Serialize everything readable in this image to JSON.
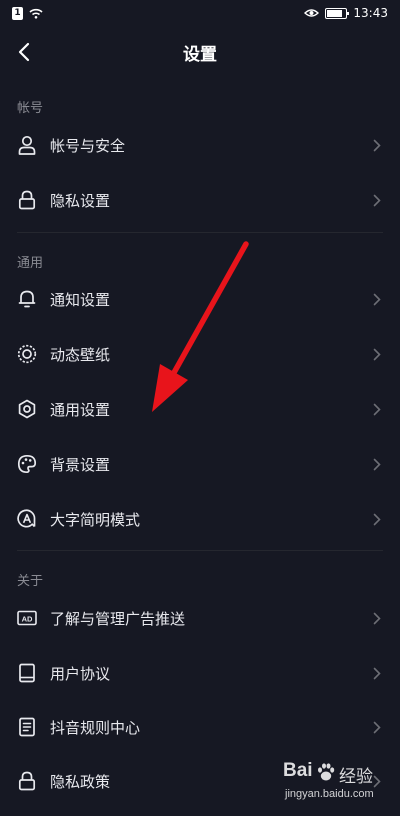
{
  "status_bar": {
    "time": "13:43",
    "sim_label": "1"
  },
  "header": {
    "title": "设置"
  },
  "sections": {
    "account": "帐号",
    "general": "通用",
    "about": "关于"
  },
  "items": [
    {
      "label": "帐号与安全",
      "icon": "person-icon"
    },
    {
      "label": "隐私设置",
      "icon": "lock-icon"
    },
    {
      "label": "通知设置",
      "icon": "bell-icon"
    },
    {
      "label": "动态壁纸",
      "icon": "live-wallpaper-icon"
    },
    {
      "label": "通用设置",
      "icon": "gear-icon"
    },
    {
      "label": "背景设置",
      "icon": "palette-icon"
    },
    {
      "label": "大字简明模式",
      "icon": "large-font-icon"
    },
    {
      "label": "了解与管理广告推送",
      "icon": "ad-icon"
    },
    {
      "label": "用户协议",
      "icon": "book-icon"
    },
    {
      "label": "抖音规则中心",
      "icon": "document-icon"
    },
    {
      "label": "隐私政策",
      "icon": "lock-icon"
    }
  ],
  "annotation": {
    "color": "#e8141b"
  },
  "watermark": {
    "logo": "Bai",
    "name": "经验",
    "url": "jingyan.baidu.com"
  },
  "colors": {
    "background": "#161823",
    "text": "#e8e9ee",
    "section": "#8a8b93",
    "chevron": "#6d6e75"
  }
}
